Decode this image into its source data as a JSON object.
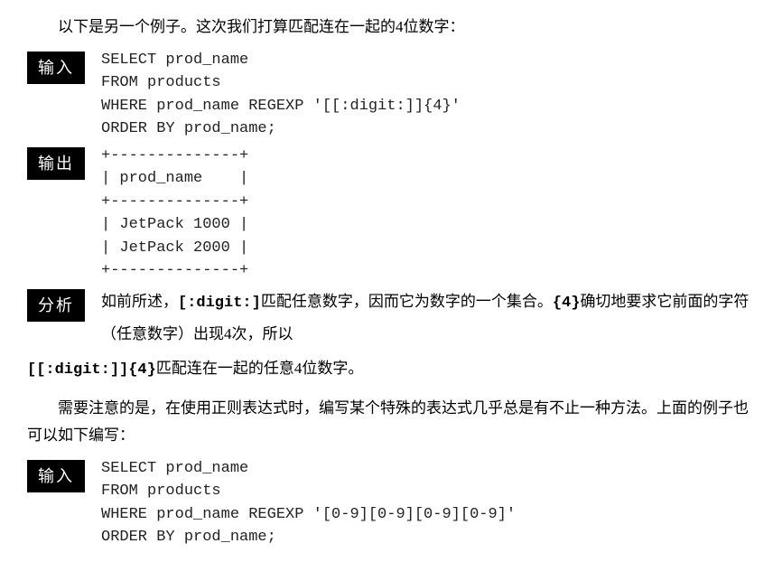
{
  "intro": "以下是另一个例子。这次我们打算匹配连在一起的4位数字：",
  "labels": {
    "input": "输入",
    "output": "输出",
    "analysis": "分析"
  },
  "code1": "SELECT prod_name\nFROM products\nWHERE prod_name REGEXP '[[:digit:]]{4}'\nORDER BY prod_name;",
  "output1": "+--------------+\n| prod_name    |\n+--------------+\n| JetPack 1000 |\n| JetPack 2000 |\n+--------------+",
  "analysis": {
    "pre1": "如前所述，",
    "code1": "[:digit:]",
    "mid1": "匹配任意数字，因而它为数字的一个集合。",
    "code2": "{4}",
    "mid2": "确切地要求它前面的字符（任意数字）出现4次，所以",
    "code3": "[[:digit:]]{4}",
    "post": "匹配连在一起的任意4位数字。"
  },
  "note": "需要注意的是，在使用正则表达式时，编写某个特殊的表达式几乎总是有不止一种方法。上面的例子也可以如下编写：",
  "code2": "SELECT prod_name\nFROM products\nWHERE prod_name REGEXP '[0-9][0-9][0-9][0-9]'\nORDER BY prod_name;"
}
